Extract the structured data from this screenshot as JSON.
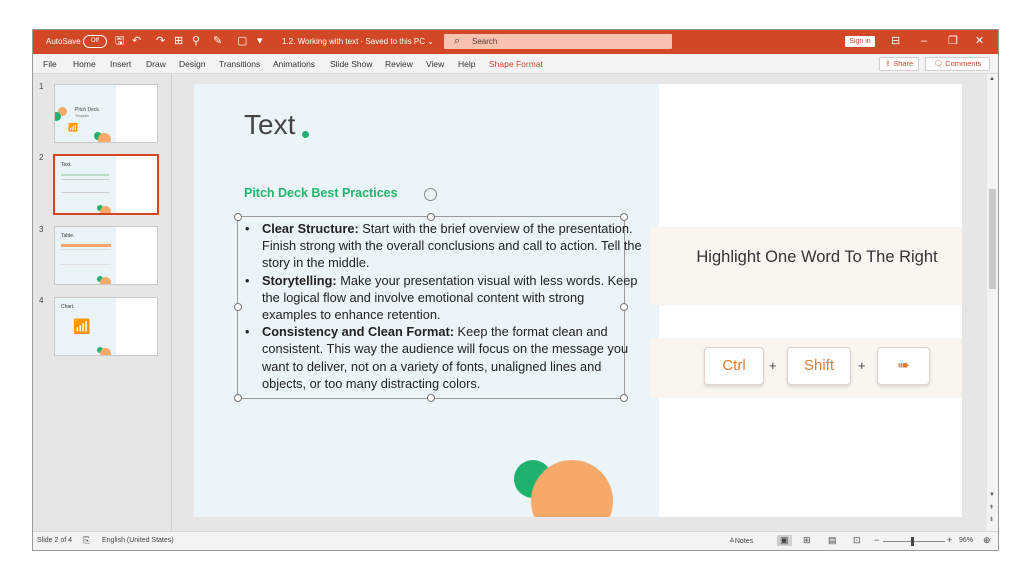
{
  "titlebar": {
    "autosave_label": "AutoSave",
    "autosave_state": "Off",
    "document_title": "1.2. Working with text  ·  Saved to this PC  ⌄",
    "search_placeholder": "Search",
    "signin_label": "Sign in"
  },
  "ribbon": {
    "tabs": [
      "File",
      "Home",
      "Insert",
      "Draw",
      "Design",
      "Transitions",
      "Animations",
      "Slide Show",
      "Review",
      "View",
      "Help",
      "Shape Format"
    ],
    "share_label": "Share",
    "comments_label": "Comments"
  },
  "thumbnails": [
    {
      "number": "1",
      "title": "Pitch Deck.",
      "subtitle": "Template"
    },
    {
      "number": "2",
      "title": "Text."
    },
    {
      "number": "3",
      "title": "Table."
    },
    {
      "number": "4",
      "title": "Chart."
    }
  ],
  "slide": {
    "title": "Text",
    "subtitle": "Pitch Deck Best Practices",
    "bullets": [
      {
        "heading": "Clear Structure:",
        "text": " Start with the brief overview of the presentation. Finish strong with the overall conclusions and call to action. Tell the story in the middle."
      },
      {
        "heading": "Storytelling:",
        "text": " Make your presentation visual with less words. Keep the logical flow and involve emotional content with strong examples to enhance retention."
      },
      {
        "heading": "Consistency and Clean Format:",
        "text": " Keep the format clean and consistent. This way the audience will focus on the message you want to deliver, not on a variety of fonts, unaligned lines and objects, or too many distracting colors."
      }
    ],
    "highlight_text": "Highlight One Word To The Right",
    "keys": [
      "Ctrl",
      "Shift"
    ],
    "plus": "+"
  },
  "statusbar": {
    "slide_info": "Slide 2 of 4",
    "language": "English (United States)",
    "notes_label": "Notes",
    "zoom_level": "96%"
  },
  "colors": {
    "accent": "#d24726",
    "green": "#1fb16d",
    "orange": "#f7a96a"
  }
}
